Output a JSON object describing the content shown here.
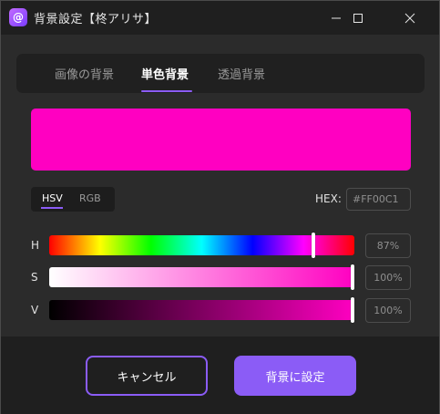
{
  "window": {
    "title": "背景設定【柊アリサ】",
    "app_icon_glyph": "@"
  },
  "tabs": [
    {
      "label": "画像の背景",
      "active": false
    },
    {
      "label": "単色背景",
      "active": true
    },
    {
      "label": "透過背景",
      "active": false
    }
  ],
  "preview": {
    "color": "#FF00C1"
  },
  "mode": {
    "options": [
      "HSV",
      "RGB"
    ],
    "active": "HSV"
  },
  "hex": {
    "label": "HEX:",
    "value": "#FF00C1"
  },
  "sliders": [
    {
      "key": "h",
      "label": "H",
      "value": 0.87,
      "display": "87%"
    },
    {
      "key": "s",
      "label": "S",
      "value": 1.0,
      "display": "100%"
    },
    {
      "key": "v",
      "label": "V",
      "value": 1.0,
      "display": "100%"
    }
  ],
  "footer": {
    "cancel_label": "キャンセル",
    "ok_label": "背景に設定"
  },
  "colors": {
    "accent": "#8B5CF6",
    "selected": "#FF00C1"
  },
  "icons": {
    "app": "app-logo-icon",
    "minimize": "minimize-icon",
    "maximize": "maximize-icon",
    "close": "close-icon"
  }
}
